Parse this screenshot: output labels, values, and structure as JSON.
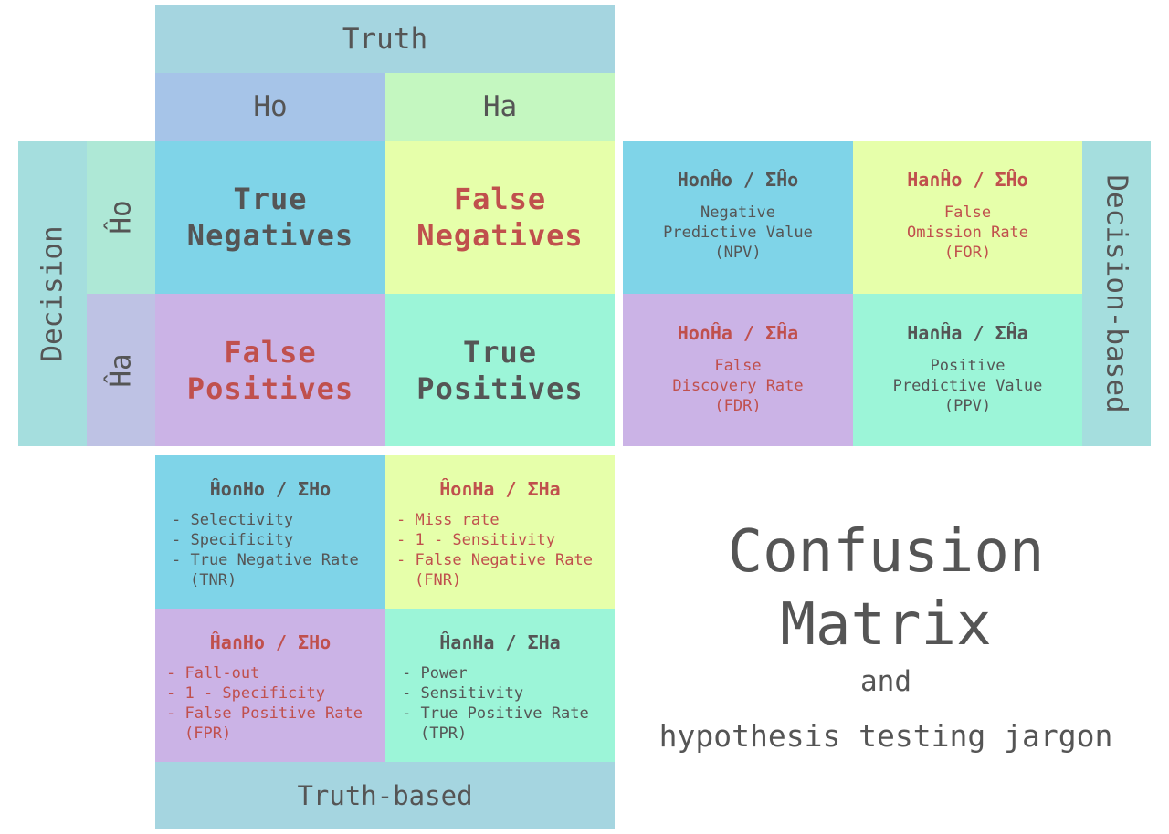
{
  "headers": {
    "truth": "Truth",
    "ho": "Ho",
    "ha": "Ha",
    "decision": "Decision",
    "ho_hat": "Ĥo",
    "ha_hat": "Ĥa",
    "decision_based": "Decision-based",
    "truth_based": "Truth-based"
  },
  "matrix": {
    "tn": [
      "True",
      "Negatives"
    ],
    "fn": [
      "False",
      "Negatives"
    ],
    "fp": [
      "False",
      "Positives"
    ],
    "tp": [
      "True",
      "Positives"
    ]
  },
  "decision_metrics": {
    "npv": {
      "formula": "Ho∩Ĥo / ΣĤo",
      "lines": [
        "Negative",
        "Predictive Value",
        "(NPV)"
      ]
    },
    "for": {
      "formula": "Ha∩Ĥo / ΣĤo",
      "lines": [
        "False",
        "Omission Rate",
        "(FOR)"
      ]
    },
    "fdr": {
      "formula": "Ho∩Ĥa / ΣĤa",
      "lines": [
        "False",
        "Discovery Rate",
        "(FDR)"
      ]
    },
    "ppv": {
      "formula": "Ha∩Ĥa / ΣĤa",
      "lines": [
        "Positive",
        "Predictive Value",
        "(PPV)"
      ]
    }
  },
  "truth_metrics": {
    "tnr": {
      "formula": "Ĥo∩Ho / ΣHo",
      "items": [
        "- Selectivity",
        "- Specificity",
        "- True Negative Rate",
        "(TNR)"
      ]
    },
    "fnr": {
      "formula": "Ĥo∩Ha / ΣHa",
      "items": [
        "- Miss rate",
        "- 1 - Sensitivity",
        "- False Negative Rate",
        "(FNR)"
      ]
    },
    "fpr": {
      "formula": "Ĥa∩Ho / ΣHo",
      "items": [
        "- Fall-out",
        "- 1 - Specificity",
        "- False Positive Rate",
        "(FPR)"
      ]
    },
    "tpr": {
      "formula": "Ĥa∩Ha / ΣHa",
      "items": [
        "- Power",
        "- Sensitivity",
        "- True Positive Rate",
        "(TPR)"
      ]
    }
  },
  "title": {
    "line1": "Confusion",
    "line2": "Matrix",
    "and": "and",
    "subtitle": "hypothesis testing jargon"
  },
  "colors": {
    "dark_text": "#555555",
    "red_text": "#c0504d",
    "true_negatives": "#7fd4e8",
    "false_negatives": "#e6ffaa",
    "false_positives": "#cbb3e6",
    "true_positives": "#9cf5d8"
  }
}
